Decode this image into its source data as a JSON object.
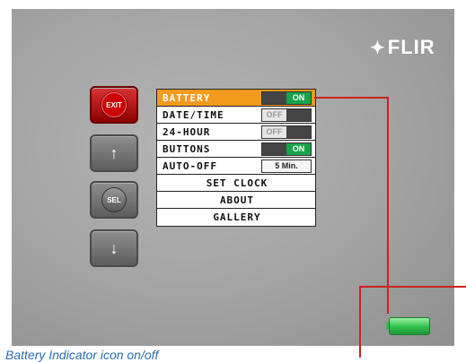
{
  "brand": {
    "logo_text": "FLIR",
    "logo_icon": "flir-logo-icon"
  },
  "side_buttons": [
    {
      "label": "EXIT",
      "icon": "exit-icon"
    },
    {
      "label": "",
      "icon": "arrow-up-icon"
    },
    {
      "label": "SEL",
      "icon": "select-icon"
    },
    {
      "label": "",
      "icon": "arrow-down-icon"
    }
  ],
  "menu": {
    "items": [
      {
        "label": "BATTERY",
        "toggle": "ON",
        "state": "on",
        "active": true
      },
      {
        "label": "DATE/TIME",
        "toggle": "OFF",
        "state": "off"
      },
      {
        "label": "24-HOUR",
        "toggle": "OFF",
        "state": "off"
      },
      {
        "label": "BUTTONS",
        "toggle": "ON",
        "state": "on"
      },
      {
        "label": "AUTO-OFF",
        "value": "5 Min."
      },
      {
        "label": "SET CLOCK"
      },
      {
        "label": "ABOUT"
      },
      {
        "label": "GALLERY"
      }
    ]
  },
  "battery_icon": "battery-icon",
  "caption": "Battery Indicator icon on/off",
  "colors": {
    "highlight": "#f39a1c",
    "toggle_on": "#16a34a",
    "exit_red": "#cc0000",
    "callout": "#cc2222",
    "caption": "#2b6cb0"
  }
}
